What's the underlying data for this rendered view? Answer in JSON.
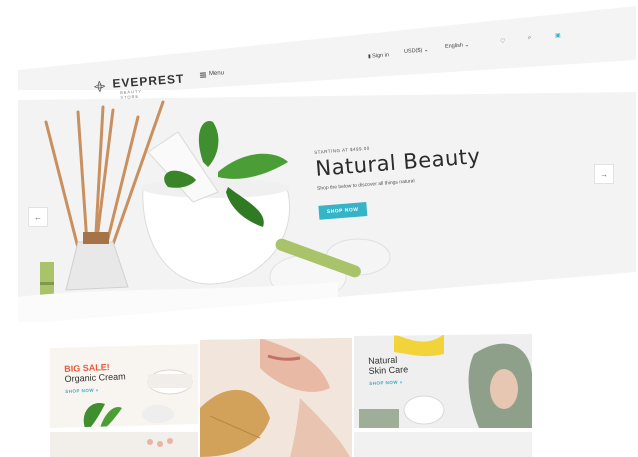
{
  "header": {
    "logo": {
      "name": "EVEPREST",
      "tagline": "BEAUTY STORE"
    },
    "menu_label": "Menu",
    "sign_in": "Sign in",
    "currency": "USD($)",
    "language": "English",
    "icons": [
      "user-icon",
      "heart-icon",
      "search-icon",
      "cart-icon"
    ]
  },
  "hero": {
    "kicker": "STARTING AT $499.00",
    "title": "Natural Beauty",
    "subtitle": "Shop the below to discover all things natural",
    "button": "SHOP NOW",
    "prev_arrow": "←",
    "next_arrow": "→"
  },
  "banners": [
    {
      "sale": "BIG SALE!",
      "title": "Organic Cream",
      "link": "SHOP NOW »"
    },
    {
      "title": "",
      "link": ""
    },
    {
      "title_line1": "Natural",
      "title_line2": "Skin Care",
      "link": "SHOP NOW »"
    }
  ],
  "colors": {
    "accent": "#35b3c7",
    "sale": "#e85a3c"
  }
}
